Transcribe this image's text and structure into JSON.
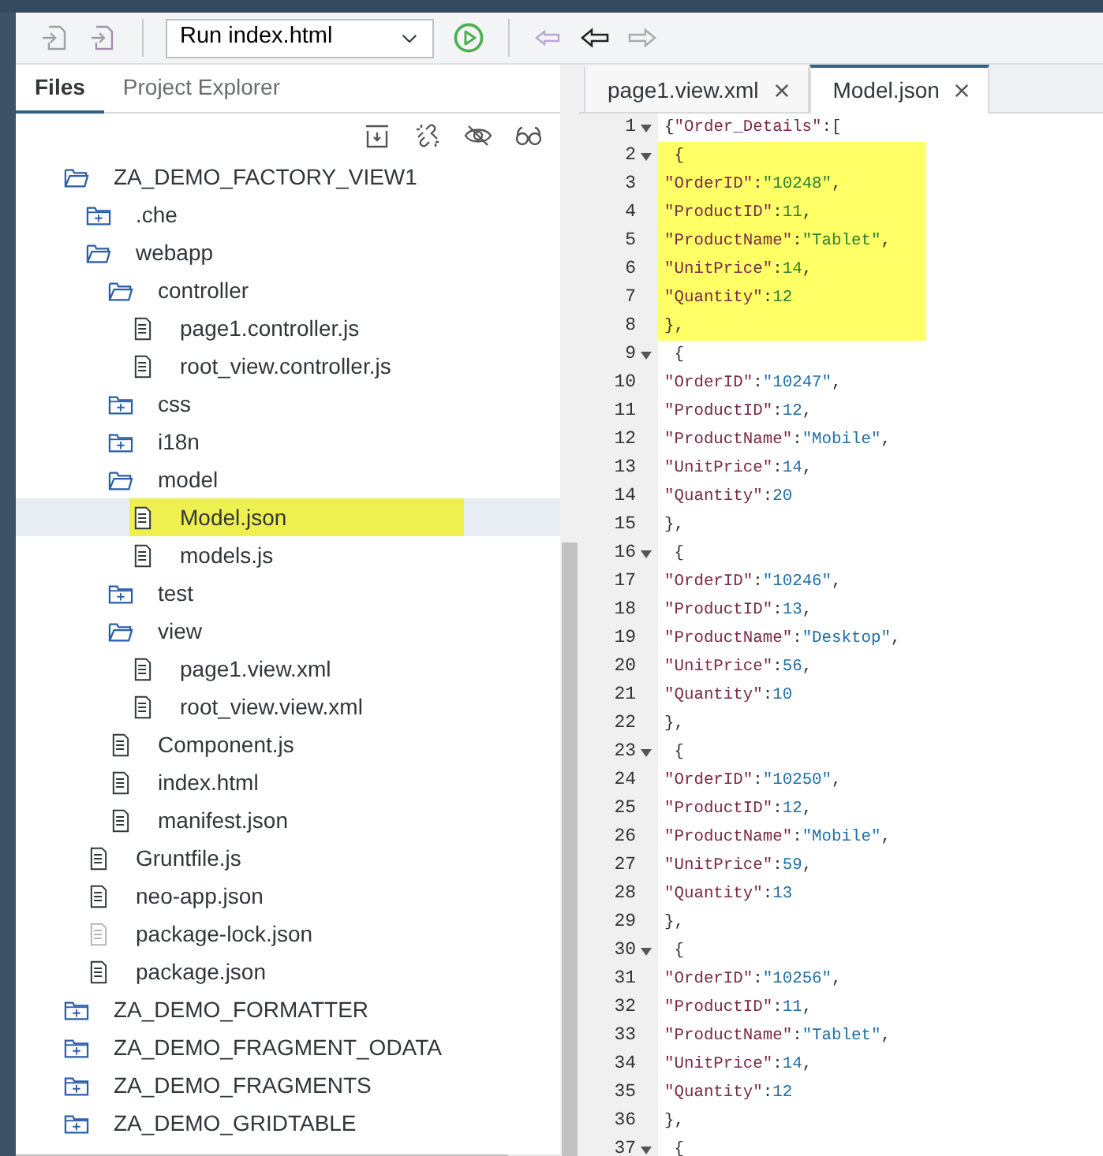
{
  "toolbar": {
    "run_config": {
      "value": "Run index.html"
    }
  },
  "left_panel": {
    "tabs": [
      {
        "label": "Files",
        "selected": true
      },
      {
        "label": "Project Explorer",
        "selected": false
      }
    ]
  },
  "tree": [
    {
      "kind": "folder",
      "name": "ZA_DEMO_FACTORY_VIEW1",
      "expanded": true,
      "selected": false,
      "highlighted": false,
      "children": [
        {
          "kind": "folder",
          "name": ".che",
          "expanded": false,
          "selected": false,
          "highlighted": false
        },
        {
          "kind": "folder",
          "name": "webapp",
          "expanded": true,
          "selected": false,
          "highlighted": false,
          "children": [
            {
              "kind": "folder",
              "name": "controller",
              "expanded": true,
              "selected": false,
              "highlighted": false,
              "children": [
                {
                  "kind": "file",
                  "name": "page1.controller.js",
                  "dimmed": false,
                  "selected": false,
                  "highlighted": false
                },
                {
                  "kind": "file",
                  "name": "root_view.controller.js",
                  "dimmed": false,
                  "selected": false,
                  "highlighted": false
                }
              ]
            },
            {
              "kind": "folder",
              "name": "css",
              "expanded": false,
              "selected": false,
              "highlighted": false
            },
            {
              "kind": "folder",
              "name": "i18n",
              "expanded": false,
              "selected": false,
              "highlighted": false
            },
            {
              "kind": "folder",
              "name": "model",
              "expanded": true,
              "selected": false,
              "highlighted": false,
              "children": [
                {
                  "kind": "file",
                  "name": "Model.json",
                  "dimmed": false,
                  "selected": true,
                  "highlighted": true
                },
                {
                  "kind": "file",
                  "name": "models.js",
                  "dimmed": false,
                  "selected": false,
                  "highlighted": false
                }
              ]
            },
            {
              "kind": "folder",
              "name": "test",
              "expanded": false,
              "selected": false,
              "highlighted": false
            },
            {
              "kind": "folder",
              "name": "view",
              "expanded": true,
              "selected": false,
              "highlighted": false,
              "children": [
                {
                  "kind": "file",
                  "name": "page1.view.xml",
                  "dimmed": false,
                  "selected": false,
                  "highlighted": false
                },
                {
                  "kind": "file",
                  "name": "root_view.view.xml",
                  "dimmed": false,
                  "selected": false,
                  "highlighted": false
                }
              ]
            },
            {
              "kind": "file",
              "name": "Component.js",
              "dimmed": false,
              "selected": false,
              "highlighted": false
            },
            {
              "kind": "file",
              "name": "index.html",
              "dimmed": false,
              "selected": false,
              "highlighted": false
            },
            {
              "kind": "file",
              "name": "manifest.json",
              "dimmed": false,
              "selected": false,
              "highlighted": false
            }
          ]
        },
        {
          "kind": "file",
          "name": "Gruntfile.js",
          "dimmed": false,
          "selected": false,
          "highlighted": false
        },
        {
          "kind": "file",
          "name": "neo-app.json",
          "dimmed": false,
          "selected": false,
          "highlighted": false
        },
        {
          "kind": "file",
          "name": "package-lock.json",
          "dimmed": true,
          "selected": false,
          "highlighted": false
        },
        {
          "kind": "file",
          "name": "package.json",
          "dimmed": false,
          "selected": false,
          "highlighted": false
        }
      ]
    },
    {
      "kind": "folder",
      "name": "ZA_DEMO_FORMATTER",
      "expanded": false,
      "selected": false,
      "highlighted": false
    },
    {
      "kind": "folder",
      "name": "ZA_DEMO_FRAGMENT_ODATA",
      "expanded": false,
      "selected": false,
      "highlighted": false
    },
    {
      "kind": "folder",
      "name": "ZA_DEMO_FRAGMENTS",
      "expanded": false,
      "selected": false,
      "highlighted": false
    },
    {
      "kind": "folder",
      "name": "ZA_DEMO_GRIDTABLE",
      "expanded": false,
      "selected": false,
      "highlighted": false
    }
  ],
  "editor": {
    "tabs": [
      {
        "label": "page1.view.xml",
        "selected": false
      },
      {
        "label": "Model.json",
        "selected": true
      }
    ],
    "lines": [
      {
        "number": "1",
        "foldable": true,
        "highlighted": false,
        "tokens": [
          {
            "kind": "punct",
            "text": "{"
          },
          {
            "kind": "key",
            "text": "\"Order_Details\""
          },
          {
            "kind": "punct",
            "text": ":["
          }
        ]
      },
      {
        "number": "2",
        "foldable": true,
        "highlighted": true,
        "tokens": [
          {
            "kind": "punct",
            "text": " {"
          }
        ]
      },
      {
        "number": "3",
        "foldable": false,
        "highlighted": true,
        "tokens": [
          {
            "kind": "key",
            "text": "\"OrderID\""
          },
          {
            "kind": "punct",
            "text": ":"
          },
          {
            "kind": "value",
            "text": "\"10248\""
          },
          {
            "kind": "punct",
            "text": ","
          }
        ]
      },
      {
        "number": "4",
        "foldable": false,
        "highlighted": true,
        "tokens": [
          {
            "kind": "key",
            "text": "\"ProductID\""
          },
          {
            "kind": "punct",
            "text": ":"
          },
          {
            "kind": "value",
            "text": "11"
          },
          {
            "kind": "punct",
            "text": ","
          }
        ]
      },
      {
        "number": "5",
        "foldable": false,
        "highlighted": true,
        "tokens": [
          {
            "kind": "key",
            "text": "\"ProductName\""
          },
          {
            "kind": "punct",
            "text": ":"
          },
          {
            "kind": "value",
            "text": "\"Tablet\""
          },
          {
            "kind": "punct",
            "text": ","
          }
        ]
      },
      {
        "number": "6",
        "foldable": false,
        "highlighted": true,
        "tokens": [
          {
            "kind": "key",
            "text": "\"UnitPrice\""
          },
          {
            "kind": "punct",
            "text": ":"
          },
          {
            "kind": "value",
            "text": "14"
          },
          {
            "kind": "punct",
            "text": ","
          }
        ]
      },
      {
        "number": "7",
        "foldable": false,
        "highlighted": true,
        "tokens": [
          {
            "kind": "key",
            "text": "\"Quantity\""
          },
          {
            "kind": "punct",
            "text": ":"
          },
          {
            "kind": "value",
            "text": "12"
          }
        ]
      },
      {
        "number": "8",
        "foldable": false,
        "highlighted": true,
        "tokens": [
          {
            "kind": "punct",
            "text": "},"
          }
        ]
      },
      {
        "number": "9",
        "foldable": true,
        "highlighted": false,
        "tokens": [
          {
            "kind": "punct",
            "text": " {"
          }
        ]
      },
      {
        "number": "10",
        "foldable": false,
        "highlighted": false,
        "tokens": [
          {
            "kind": "key",
            "text": "\"OrderID\""
          },
          {
            "kind": "punct",
            "text": ":"
          },
          {
            "kind": "value",
            "text": "\"10247\""
          },
          {
            "kind": "punct",
            "text": ","
          }
        ]
      },
      {
        "number": "11",
        "foldable": false,
        "highlighted": false,
        "tokens": [
          {
            "kind": "key",
            "text": "\"ProductID\""
          },
          {
            "kind": "punct",
            "text": ":"
          },
          {
            "kind": "value",
            "text": "12"
          },
          {
            "kind": "punct",
            "text": ","
          }
        ]
      },
      {
        "number": "12",
        "foldable": false,
        "highlighted": false,
        "tokens": [
          {
            "kind": "key",
            "text": "\"ProductName\""
          },
          {
            "kind": "punct",
            "text": ":"
          },
          {
            "kind": "value",
            "text": "\"Mobile\""
          },
          {
            "kind": "punct",
            "text": ","
          }
        ]
      },
      {
        "number": "13",
        "foldable": false,
        "highlighted": false,
        "tokens": [
          {
            "kind": "key",
            "text": "\"UnitPrice\""
          },
          {
            "kind": "punct",
            "text": ":"
          },
          {
            "kind": "value",
            "text": "14"
          },
          {
            "kind": "punct",
            "text": ","
          }
        ]
      },
      {
        "number": "14",
        "foldable": false,
        "highlighted": false,
        "tokens": [
          {
            "kind": "key",
            "text": "\"Quantity\""
          },
          {
            "kind": "punct",
            "text": ":"
          },
          {
            "kind": "value",
            "text": "20"
          }
        ]
      },
      {
        "number": "15",
        "foldable": false,
        "highlighted": false,
        "tokens": [
          {
            "kind": "punct",
            "text": "},"
          }
        ]
      },
      {
        "number": "16",
        "foldable": true,
        "highlighted": false,
        "tokens": [
          {
            "kind": "punct",
            "text": " {"
          }
        ]
      },
      {
        "number": "17",
        "foldable": false,
        "highlighted": false,
        "tokens": [
          {
            "kind": "key",
            "text": "\"OrderID\""
          },
          {
            "kind": "punct",
            "text": ":"
          },
          {
            "kind": "value",
            "text": "\"10246\""
          },
          {
            "kind": "punct",
            "text": ","
          }
        ]
      },
      {
        "number": "18",
        "foldable": false,
        "highlighted": false,
        "tokens": [
          {
            "kind": "key",
            "text": "\"ProductID\""
          },
          {
            "kind": "punct",
            "text": ":"
          },
          {
            "kind": "value",
            "text": "13"
          },
          {
            "kind": "punct",
            "text": ","
          }
        ]
      },
      {
        "number": "19",
        "foldable": false,
        "highlighted": false,
        "tokens": [
          {
            "kind": "key",
            "text": "\"ProductName\""
          },
          {
            "kind": "punct",
            "text": ":"
          },
          {
            "kind": "value",
            "text": "\"Desktop\""
          },
          {
            "kind": "punct",
            "text": ","
          }
        ]
      },
      {
        "number": "20",
        "foldable": false,
        "highlighted": false,
        "tokens": [
          {
            "kind": "key",
            "text": "\"UnitPrice\""
          },
          {
            "kind": "punct",
            "text": ":"
          },
          {
            "kind": "value",
            "text": "56"
          },
          {
            "kind": "punct",
            "text": ","
          }
        ]
      },
      {
        "number": "21",
        "foldable": false,
        "highlighted": false,
        "tokens": [
          {
            "kind": "key",
            "text": "\"Quantity\""
          },
          {
            "kind": "punct",
            "text": ":"
          },
          {
            "kind": "value",
            "text": "10"
          }
        ]
      },
      {
        "number": "22",
        "foldable": false,
        "highlighted": false,
        "tokens": [
          {
            "kind": "punct",
            "text": "},"
          }
        ]
      },
      {
        "number": "23",
        "foldable": true,
        "highlighted": false,
        "tokens": [
          {
            "kind": "punct",
            "text": " {"
          }
        ]
      },
      {
        "number": "24",
        "foldable": false,
        "highlighted": false,
        "tokens": [
          {
            "kind": "key",
            "text": "\"OrderID\""
          },
          {
            "kind": "punct",
            "text": ":"
          },
          {
            "kind": "value",
            "text": "\"10250\""
          },
          {
            "kind": "punct",
            "text": ","
          }
        ]
      },
      {
        "number": "25",
        "foldable": false,
        "highlighted": false,
        "tokens": [
          {
            "kind": "key",
            "text": "\"ProductID\""
          },
          {
            "kind": "punct",
            "text": ":"
          },
          {
            "kind": "value",
            "text": "12"
          },
          {
            "kind": "punct",
            "text": ","
          }
        ]
      },
      {
        "number": "26",
        "foldable": false,
        "highlighted": false,
        "tokens": [
          {
            "kind": "key",
            "text": "\"ProductName\""
          },
          {
            "kind": "punct",
            "text": ":"
          },
          {
            "kind": "value",
            "text": "\"Mobile\""
          },
          {
            "kind": "punct",
            "text": ","
          }
        ]
      },
      {
        "number": "27",
        "foldable": false,
        "highlighted": false,
        "tokens": [
          {
            "kind": "key",
            "text": "\"UnitPrice\""
          },
          {
            "kind": "punct",
            "text": ":"
          },
          {
            "kind": "value",
            "text": "59"
          },
          {
            "kind": "punct",
            "text": ","
          }
        ]
      },
      {
        "number": "28",
        "foldable": false,
        "highlighted": false,
        "tokens": [
          {
            "kind": "key",
            "text": "\"Quantity\""
          },
          {
            "kind": "punct",
            "text": ":"
          },
          {
            "kind": "value",
            "text": "13"
          }
        ]
      },
      {
        "number": "29",
        "foldable": false,
        "highlighted": false,
        "tokens": [
          {
            "kind": "punct",
            "text": "},"
          }
        ]
      },
      {
        "number": "30",
        "foldable": true,
        "highlighted": false,
        "tokens": [
          {
            "kind": "punct",
            "text": " {"
          }
        ]
      },
      {
        "number": "31",
        "foldable": false,
        "highlighted": false,
        "tokens": [
          {
            "kind": "key",
            "text": "\"OrderID\""
          },
          {
            "kind": "punct",
            "text": ":"
          },
          {
            "kind": "value",
            "text": "\"10256\""
          },
          {
            "kind": "punct",
            "text": ","
          }
        ]
      },
      {
        "number": "32",
        "foldable": false,
        "highlighted": false,
        "tokens": [
          {
            "kind": "key",
            "text": "\"ProductID\""
          },
          {
            "kind": "punct",
            "text": ":"
          },
          {
            "kind": "value",
            "text": "11"
          },
          {
            "kind": "punct",
            "text": ","
          }
        ]
      },
      {
        "number": "33",
        "foldable": false,
        "highlighted": false,
        "tokens": [
          {
            "kind": "key",
            "text": "\"ProductName\""
          },
          {
            "kind": "punct",
            "text": ":"
          },
          {
            "kind": "value",
            "text": "\"Tablet\""
          },
          {
            "kind": "punct",
            "text": ","
          }
        ]
      },
      {
        "number": "34",
        "foldable": false,
        "highlighted": false,
        "tokens": [
          {
            "kind": "key",
            "text": "\"UnitPrice\""
          },
          {
            "kind": "punct",
            "text": ":"
          },
          {
            "kind": "value",
            "text": "14"
          },
          {
            "kind": "punct",
            "text": ","
          }
        ]
      },
      {
        "number": "35",
        "foldable": false,
        "highlighted": false,
        "tokens": [
          {
            "kind": "key",
            "text": "\"Quantity\""
          },
          {
            "kind": "punct",
            "text": ":"
          },
          {
            "kind": "value",
            "text": "12"
          }
        ]
      },
      {
        "number": "36",
        "foldable": false,
        "highlighted": false,
        "tokens": [
          {
            "kind": "punct",
            "text": "},"
          }
        ]
      },
      {
        "number": "37",
        "foldable": true,
        "highlighted": false,
        "tokens": [
          {
            "kind": "punct",
            "text": " {"
          }
        ]
      }
    ]
  }
}
